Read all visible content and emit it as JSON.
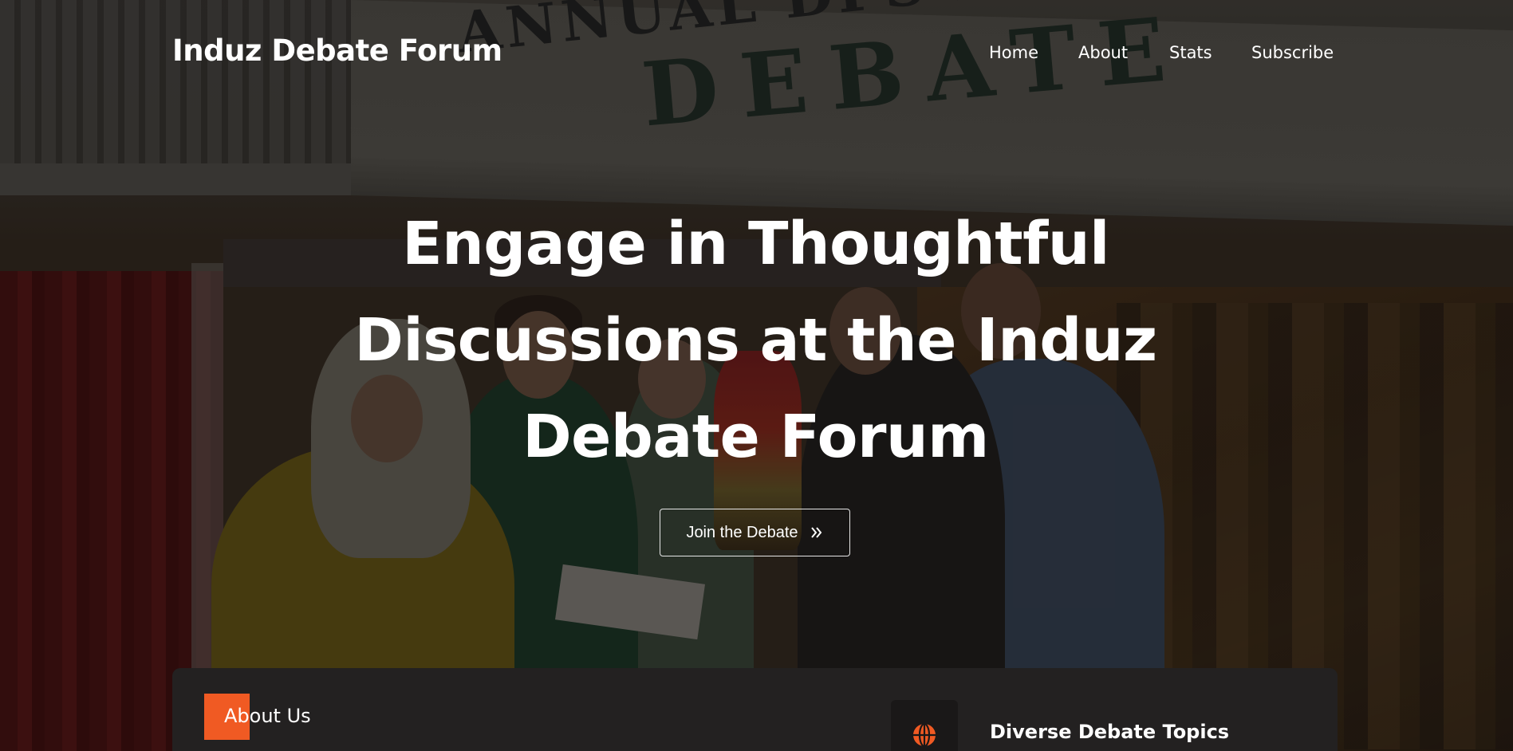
{
  "header": {
    "brand": "Induz Debate Forum",
    "nav": [
      {
        "label": "Home"
      },
      {
        "label": "About"
      },
      {
        "label": "Stats"
      },
      {
        "label": "Subscribe"
      }
    ]
  },
  "hero": {
    "banner_line_1": "ANNUAL DPS INTER-SC",
    "banner_line_2": "DEBATE",
    "headline": "Engage in Thoughtful Discussions at the Induz Debate Forum",
    "cta_label": "Join the Debate",
    "cta_icon": "double-chevron-right-icon"
  },
  "about_card": {
    "section_label": "About Us",
    "feature_title": "Diverse Debate Topics",
    "feature_icon": "globe-icon"
  },
  "colors": {
    "accent": "#f05a23",
    "card_bg": "#232121",
    "text": "#ffffff"
  }
}
